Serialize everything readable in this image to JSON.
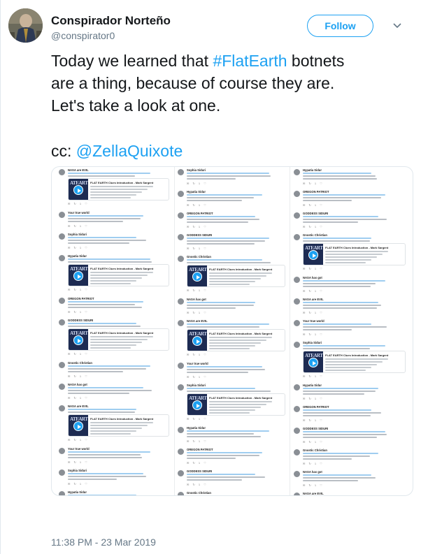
{
  "author": {
    "name": "Conspirador Norteño",
    "handle": "@conspirator0"
  },
  "follow_button": {
    "label": "Follow"
  },
  "tweet": {
    "lines": [
      {
        "before": "Today we learned that ",
        "hashtag": "#FlatEarth",
        "after": " botnets"
      },
      {
        "text": "are a thing, because of course they are."
      },
      {
        "text": "Let's take a look at one."
      }
    ],
    "cc_prefix": "cc: ",
    "cc_mention": "@ZellaQuixote"
  },
  "timestamp": "11:38 PM - 23 Mar 2019",
  "media": {
    "columns": [
      [
        "v",
        "s",
        "s",
        "v",
        "s",
        "v",
        "s",
        "s",
        "v",
        "s",
        "s",
        "s",
        "s",
        "s",
        "s"
      ],
      [
        "s",
        "s",
        "s",
        "s",
        "v",
        "s",
        "v",
        "s",
        "v",
        "s",
        "s",
        "s",
        "s",
        "s"
      ],
      [
        "s",
        "s",
        "s",
        "v",
        "s",
        "s",
        "s",
        "v",
        "s",
        "s",
        "s",
        "s",
        "s",
        "s"
      ]
    ],
    "names": [
      "NASA are EVIL",
      "Your true world",
      "Sophia Siduri",
      "Hypatia Sidur",
      "OREGON PATRIOT",
      "GODDESS SIDURI",
      "Gnostic Christian",
      "NASA has got"
    ],
    "video_title": "FLAT EARTH Clues Introduction - Mark Sargent",
    "thumb_text": "ATEART"
  },
  "colors": {
    "link": "#1da1f2",
    "text": "#14171a",
    "muted": "#657786"
  }
}
